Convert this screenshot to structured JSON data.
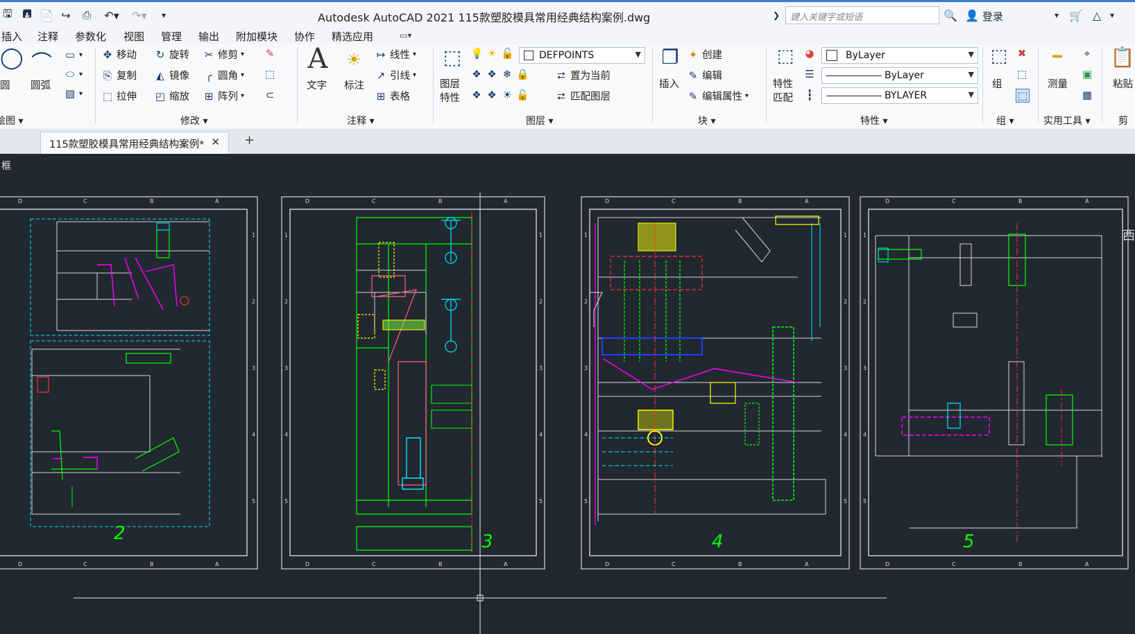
{
  "app": {
    "title": "Autodesk AutoCAD 2021    115款塑胶模具常用经典结构案例.dwg",
    "search_placeholder": "键入关键字或短语",
    "login": "登录"
  },
  "menus": [
    "插入",
    "注释",
    "参数化",
    "视图",
    "管理",
    "输出",
    "附加模块",
    "协作",
    "精选应用"
  ],
  "ribbon": {
    "draw": {
      "circle": "圆",
      "arc": "圆弧",
      "panel": "绘图"
    },
    "modify": {
      "move": "移动",
      "rotate": "旋转",
      "trim": "修剪",
      "copy": "复制",
      "mirror": "镜像",
      "fillet": "圆角",
      "stretch": "拉伸",
      "scale": "缩放",
      "array": "阵列",
      "panel": "修改"
    },
    "annotation": {
      "text": "文字",
      "dimension": "标注",
      "linear": "线性",
      "leader": "引线",
      "table": "表格",
      "panel": "注释"
    },
    "layers": {
      "layer_props_1": "图层",
      "layer_props_2": "特性",
      "current_layer": "DEFPOINTS",
      "set_current": "置为当前",
      "match_layer": "匹配图层",
      "panel": "图层"
    },
    "block": {
      "insert": "插入",
      "create": "创建",
      "edit": "编辑",
      "edit_attr": "编辑属性",
      "panel": "块"
    },
    "properties": {
      "match_1": "特性",
      "match_2": "匹配",
      "color": "ByLayer",
      "linetype": "ByLayer",
      "lineweight": "BYLAYER",
      "panel": "特性"
    },
    "groups": {
      "group": "组",
      "panel": "组"
    },
    "utilities": {
      "measure": "测量",
      "panel": "实用工具"
    },
    "clipboard": {
      "paste": "粘贴",
      "panel": "剪"
    }
  },
  "tabs": {
    "doc_tab": "115款塑胶模具常用经典结构案例*",
    "add": "+"
  },
  "canvas": {
    "viewport_label": "[-][俯视][二维线框]",
    "viewport_label_visible": "框",
    "sheet_numbers": [
      "2",
      "3",
      "4",
      "5"
    ],
    "edge_letters": [
      "D",
      "C",
      "B",
      "A"
    ],
    "edge_numbers": [
      "1",
      "2",
      "3",
      "4",
      "5"
    ],
    "cut_word": "西"
  },
  "colors": {
    "canvas_bg": "#212830",
    "sheet_line": "#d8d8d8",
    "green": "#00ff00",
    "cyan": "#00e5ff",
    "magenta": "#ff00ff",
    "red": "#ff3030",
    "yellow": "#ffff00",
    "white": "#e8e8e8"
  }
}
